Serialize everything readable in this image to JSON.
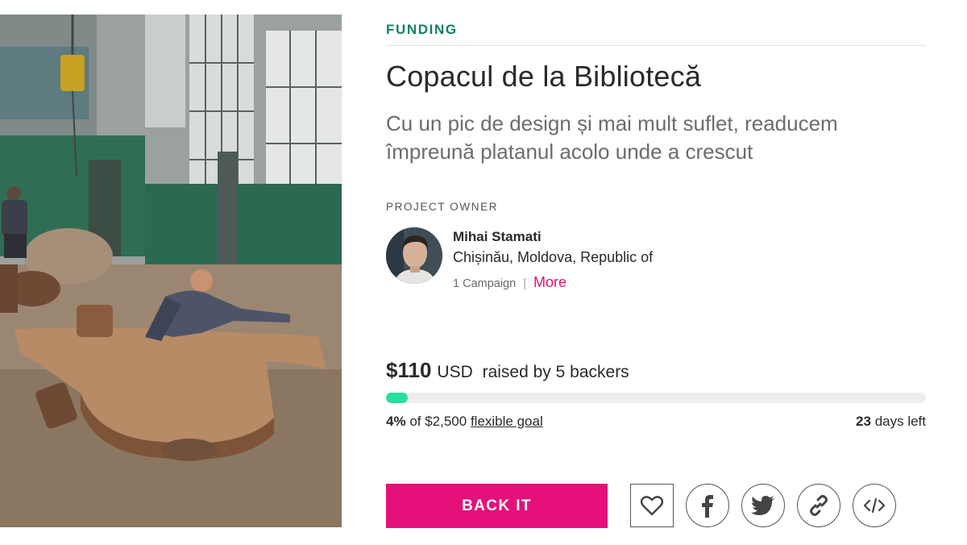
{
  "campaign": {
    "category": "FUNDING",
    "title": "Copacul de la Bibliotecă",
    "subtitle": "Cu un pic de design și mai mult suflet, readucem împreună platanul acolo unde a crescut"
  },
  "owner": {
    "section_label": "PROJECT OWNER",
    "name": "Mihai Stamati",
    "location": "Chișinău, Moldova, Republic of",
    "campaigns": "1 Campaign",
    "separator": "|",
    "more_label": "More"
  },
  "funding": {
    "amount": "$110",
    "currency": "USD",
    "raised_text": "raised by 5 backers",
    "progress_fraction": 0.04,
    "percent": "4%",
    "of_text": "of $2,500",
    "goal_link": "flexible goal",
    "days_number": "23",
    "days_text": "days left"
  },
  "actions": {
    "back_label": "BACK IT",
    "icons": [
      "heart-icon",
      "facebook-icon",
      "twitter-icon",
      "link-icon",
      "embed-icon"
    ]
  },
  "colors": {
    "category": "#128066",
    "accent": "#e5107a",
    "progress": "#2bde9d",
    "progress_track": "#eeeeee"
  }
}
